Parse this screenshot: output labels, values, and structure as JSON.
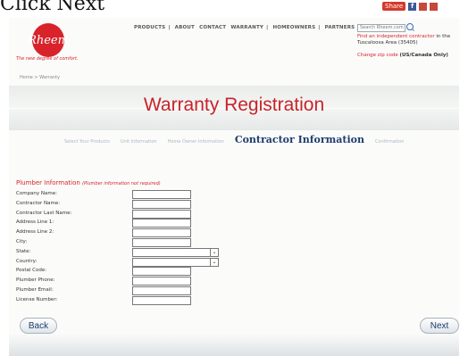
{
  "caption": "Click Next",
  "share": {
    "label": "Share",
    "fb": "f"
  },
  "header": {
    "logo": "Rheem",
    "tagline": "The new degree of comfort.",
    "nav": [
      "PRODUCTS",
      "|",
      "ABOUT",
      "CONTACT",
      "WARRANTY",
      "|",
      "HOMEOWNERS",
      "|",
      "PARTNERS"
    ],
    "search_placeholder": "Search Rheem.com",
    "find_link": "Find an independent contractor",
    "find_suffix": "in the",
    "area": "Tuscaloosa Area (35405)",
    "zip_link": "Change zip code",
    "zip_suffix": "(US/Canada Only)"
  },
  "breadcrumb": "Home  >  Warranty",
  "page_title": "Warranty Registration",
  "steps": [
    "Select Your Products",
    "Unit Information",
    "Home Owner Information",
    "Contractor Information",
    "Confirmation"
  ],
  "section": {
    "title": "Plumber Information",
    "note": "(Plumber information not required)"
  },
  "fields": [
    {
      "label": "Company Name:",
      "type": "text",
      "value": ""
    },
    {
      "label": "Contractor Name:",
      "type": "text",
      "value": ""
    },
    {
      "label": "Contractor Last Name:",
      "type": "text",
      "value": ""
    },
    {
      "label": "Address Line 1:",
      "type": "text",
      "value": ""
    },
    {
      "label": "Address Line 2:",
      "type": "text",
      "value": ""
    },
    {
      "label": "City:",
      "type": "text",
      "value": ""
    },
    {
      "label": "State:",
      "type": "select",
      "value": ""
    },
    {
      "label": "Country:",
      "type": "select",
      "value": ""
    },
    {
      "label": "Postal Code:",
      "type": "text",
      "value": ""
    },
    {
      "label": "Plumber Phone:",
      "type": "text",
      "value": ""
    },
    {
      "label": "Plumber Email:",
      "type": "text",
      "value": ""
    },
    {
      "label": "License Number:",
      "type": "text",
      "value": ""
    }
  ],
  "buttons": {
    "back": "Back",
    "next": "Next"
  }
}
